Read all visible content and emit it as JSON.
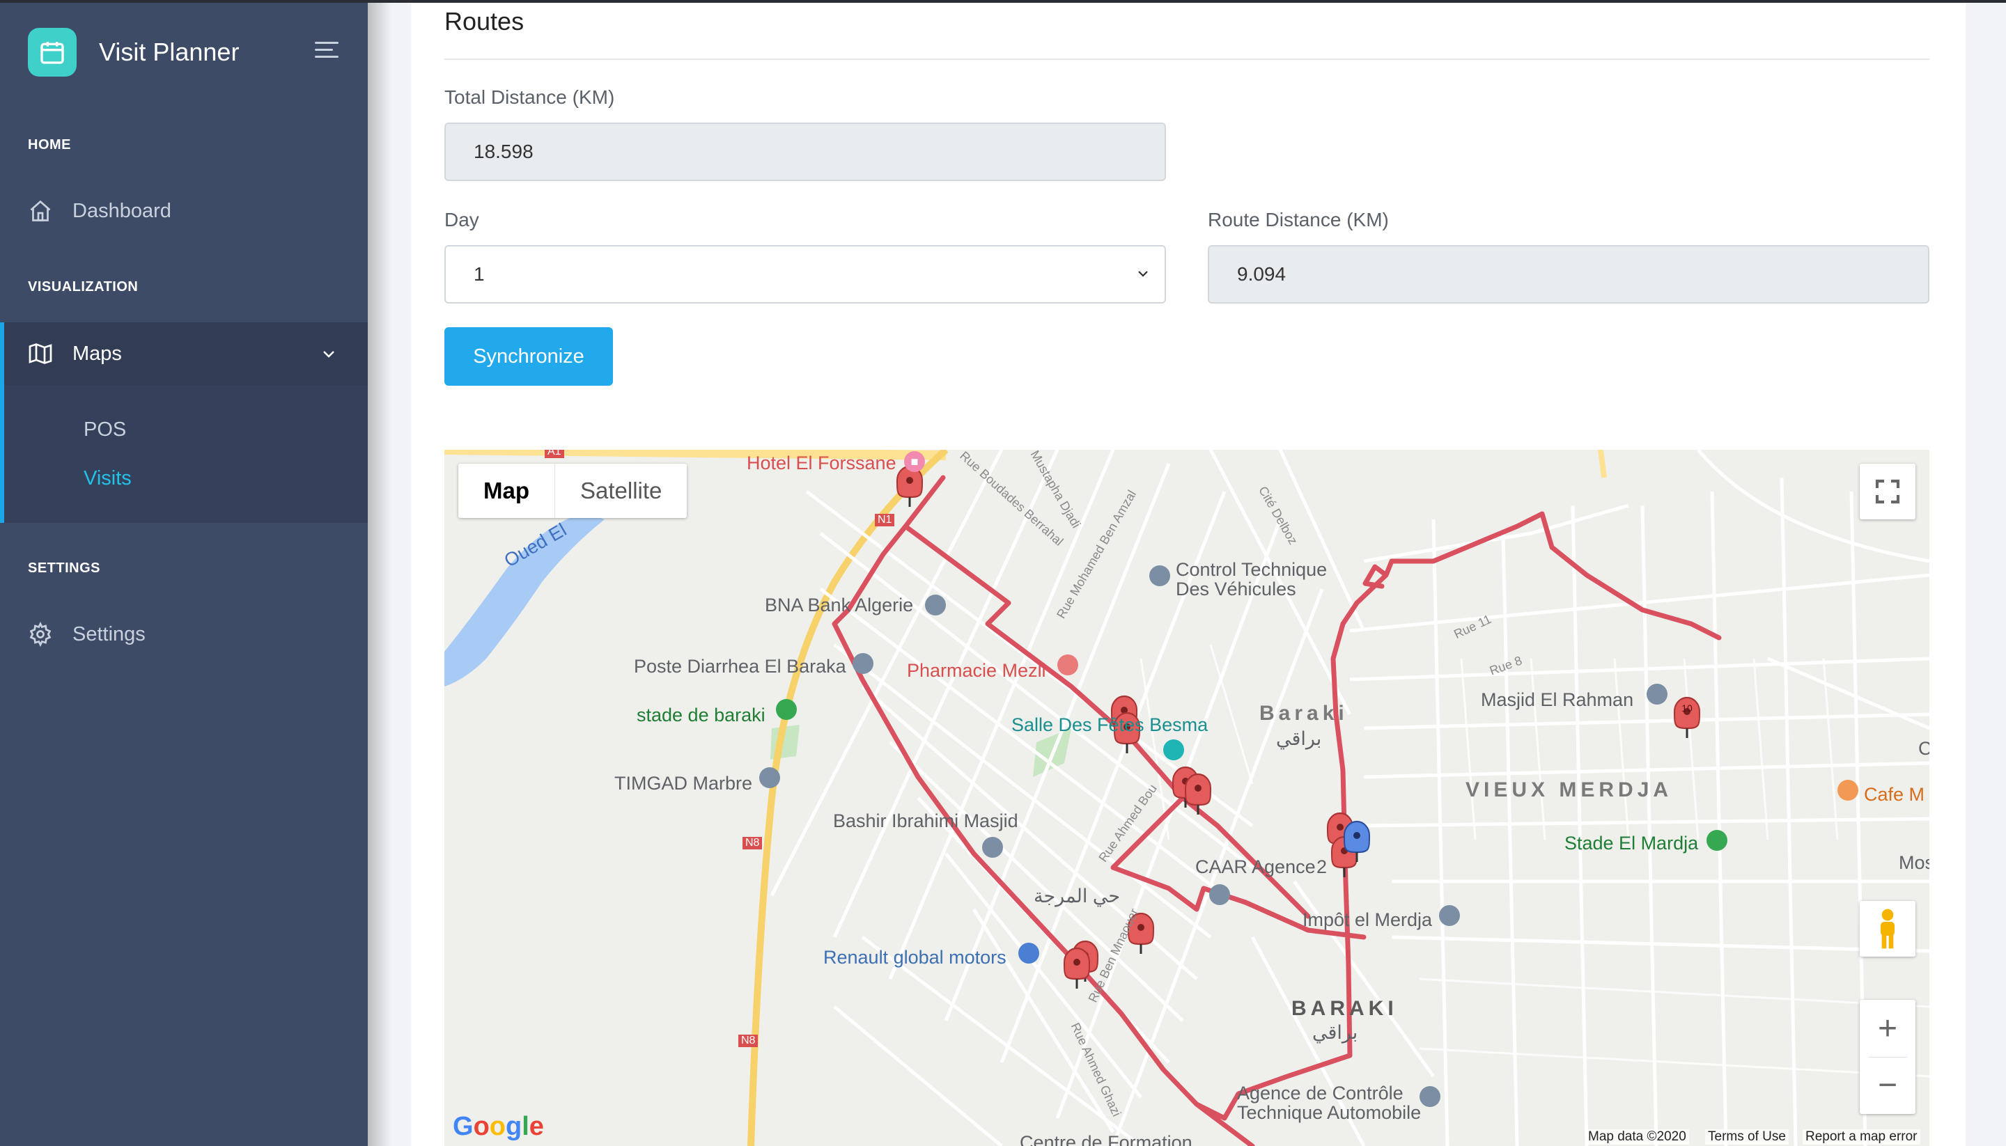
{
  "app": {
    "name": "Visit Planner"
  },
  "sidebar": {
    "sections": {
      "home": "HOME",
      "visualization": "VISUALIZATION",
      "settings": "SETTINGS"
    },
    "items": {
      "dashboard": "Dashboard",
      "maps": "Maps",
      "pos": "POS",
      "visits": "Visits",
      "settings": "Settings"
    }
  },
  "routes": {
    "title": "Routes",
    "total_distance_label": "Total Distance (KM)",
    "total_distance_value": "18.598",
    "day_label": "Day",
    "day_value": "1",
    "route_distance_label": "Route Distance (KM)",
    "route_distance_value": "9.094",
    "sync_button": "Synchronize"
  },
  "map": {
    "type_options": [
      "Map",
      "Satellite"
    ],
    "selected_type": "Map",
    "route_color": "#d9505f",
    "places": {
      "hotel": "Hotel El Forssane",
      "control": "Control Technique\nDes Véhicules",
      "bna": "BNA Bank Algerie",
      "poste": "Poste Diarrhea El Baraka",
      "pharmacie": "Pharmacie Mezli",
      "stade_baraki": "stade de baraki",
      "salle": "Salle Des Fêtes Besma",
      "timgad": "TIMGAD Marbre",
      "bashir": "Bashir Ibrahimi Masjid",
      "caar": "CAAR Agence",
      "caar_suffix": "2",
      "renault": "Renault global motors",
      "masjid_rahman": "Masjid El Rahman",
      "stade_merdja": "Stade El Mardja",
      "impot": "Impôt el Merdja",
      "cafe": "Cafe M",
      "mos": "Mos",
      "agence_controle": "Agence de Contrôle\nTechnique Automobile",
      "centre": "Centre de Formation",
      "oued": "Oued El",
      "baraki_top": "Baraki",
      "baraki_top_ar": "براقي",
      "baraki_big": "BARAKI",
      "baraki_big_ar": "براقي",
      "vieux_merdja": "VIEUX MERDJA",
      "hay_merdja_ar": "حي المرجة",
      "c_left": "C"
    },
    "street_labels": {
      "mustapha": "Rue Mustapha Djadi",
      "boudades": "Rue Boudades Berrahal",
      "ben_amzal": "Rue Mohamed Ben Amzal",
      "cite_delboz": "Cité Delboz",
      "rue_11": "Rue 11",
      "rue_8": "Rue 8",
      "ahmed_bou": "Rue Ahmed Bou",
      "ahmed_ghazi": "Rue Ahmed Ghazi",
      "mnaouer": "Rue Ben Mnaouer",
      "n8_a": "N8",
      "n8_b": "N8",
      "n1": "N1",
      "a1": "A1"
    },
    "attribution": {
      "data": "Map data ©2020",
      "terms": "Terms of Use",
      "report": "Report a map error",
      "google": "Google"
    },
    "markers": [
      {
        "label": "",
        "color": "red"
      },
      {
        "label": "",
        "color": "red"
      },
      {
        "label": "",
        "color": "red"
      },
      {
        "label": "",
        "color": "red"
      },
      {
        "label": "",
        "color": "red"
      },
      {
        "label": "",
        "color": "red"
      },
      {
        "label": "",
        "color": "red"
      },
      {
        "label": "",
        "color": "red"
      },
      {
        "label": "",
        "color": "red"
      },
      {
        "label": "",
        "color": "red"
      },
      {
        "label": "10",
        "color": "red"
      },
      {
        "label": "",
        "color": "blue"
      }
    ]
  }
}
